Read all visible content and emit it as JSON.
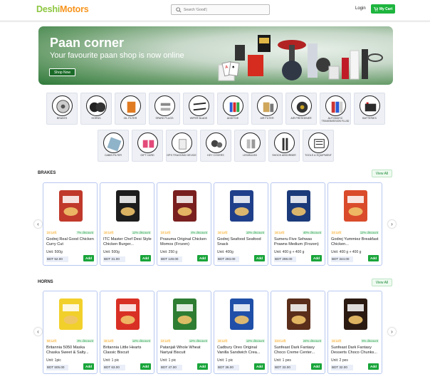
{
  "header": {
    "logo_part1": "Deshi",
    "logo_part2": "Motors",
    "search_placeholder": "Search 'Good'|",
    "login_label": "Login",
    "cart_label": "My Cart"
  },
  "banner": {
    "title": "Paan corner",
    "subtitle": "Your favourite paan shop is now online",
    "shop_button": "Shop Now"
  },
  "categories_row1": [
    {
      "label": "BRAKES",
      "icon": "brakes-icon"
    },
    {
      "label": "HORNS",
      "icon": "horn-icon"
    },
    {
      "label": "OIL FILTER",
      "icon": "oil-filter-icon"
    },
    {
      "label": "SPARK PLUGS",
      "icon": "spark-plug-icon"
    },
    {
      "label": "WIPER BLADE",
      "icon": "wiper-blade-icon"
    },
    {
      "label": "ADDITIVE",
      "icon": "additive-icon"
    },
    {
      "label": "AIR FILTER",
      "icon": "air-filter-icon"
    },
    {
      "label": "AIR FRESHENER",
      "icon": "air-freshener-icon"
    },
    {
      "label": "AUTOMATIC TRANSMISSION FLUID",
      "icon": "transmission-fluid-icon"
    },
    {
      "label": "BATTERIES",
      "icon": "battery-icon"
    }
  ],
  "categories_row2": [
    {
      "label": "CABIN FILTER",
      "icon": "cabin-filter-icon"
    },
    {
      "label": "GIFT CARD",
      "icon": "gift-card-icon"
    },
    {
      "label": "GPS TRACKING DEVICE",
      "icon": "gps-device-icon"
    },
    {
      "label": "KEY COVERS",
      "icon": "key-cover-icon"
    },
    {
      "label": "LED/BULBS",
      "icon": "bulb-icon"
    },
    {
      "label": "SHOCK ABSORBER",
      "icon": "shock-absorber-icon"
    },
    {
      "label": "TOOLS & EQUIPMENT",
      "icon": "tools-icon"
    }
  ],
  "sections": [
    {
      "title": "BRAKES",
      "view_all": "View All",
      "products": [
        {
          "left": "24 Left",
          "discount": "7% discount",
          "name": "Godrej Real Good Chicken Curry Cut",
          "unit": "Unit: 500g",
          "price": "BDT 52.00",
          "add": "Add",
          "color": "#c0392b"
        },
        {
          "left": "16 Left",
          "discount": "12% discount",
          "name": "ITC Master Chef Desi Style Chicken Burger...",
          "unit": "Unit: 500g",
          "price": "BDT 31.00",
          "add": "Add",
          "color": "#1d1d1d"
        },
        {
          "left": "24 Left",
          "discount": "4% discount",
          "name": "Prasuma Original Chicken Momos (Frozen)",
          "unit": "Unit: 250 g",
          "price": "BDT 149.00",
          "add": "Add",
          "color": "#7a1f1f"
        },
        {
          "left": "16 Left",
          "discount": "10% discount",
          "name": "Godrej Seafood Seafood Snack",
          "unit": "Unit: 400g",
          "price": "BDT 293.00",
          "add": "Add",
          "color": "#1f3f8a"
        },
        {
          "left": "16 Left",
          "discount": "40% discount",
          "name": "Sumeru Five Sehwas Prawns Medium (Frozen)",
          "unit": "Unit: 400 g + 400 g",
          "price": "BDT 298.00",
          "add": "Add",
          "color": "#1b3a7a"
        },
        {
          "left": "24 Left",
          "discount": "12% discount",
          "name": "Godrej Yummiez Breakfast Chicken...",
          "unit": "Unit: 400 g + 400 g",
          "price": "BDT 344.00",
          "add": "Add",
          "color": "#d94b2b"
        }
      ]
    },
    {
      "title": "HORNS",
      "view_all": "View All",
      "products": [
        {
          "left": "56 Left",
          "discount": "3% discount",
          "name": "Britannia 5050 Maska Chaska Sweet & Salty...",
          "unit": "Unit: 1pic",
          "price": "BDT 505.00",
          "add": "Add",
          "color": "#f2d02b"
        },
        {
          "left": "16 Left",
          "discount": "12% discount",
          "name": "Britannia Little Hearts Classic Biscuit",
          "unit": "Unit: 1 pic",
          "price": "BDT 63.00",
          "add": "Add",
          "color": "#d93025"
        },
        {
          "left": "24 Left",
          "discount": "12% discount",
          "name": "Patanjali Whole Wheat Nariyal Biscuit",
          "unit": "Unit: 1 pic",
          "price": "BDT 47.00",
          "add": "Add",
          "color": "#2e7d32"
        },
        {
          "left": "16 Left",
          "discount": "12% discount",
          "name": "Cadbury Oreo Original Vanilla Sandwich Crea...",
          "unit": "Unit: 1 pic",
          "price": "BDT 36.00",
          "add": "Add",
          "color": "#1f4fa8"
        },
        {
          "left": "224 Left",
          "discount": "24% discount",
          "name": "Sunfeast Dark Fantasy Choco Creme Center...",
          "unit": "Unit: 1 pes",
          "price": "BDT 33.00",
          "add": "Add",
          "color": "#5a2e1a"
        },
        {
          "left": "16 Left",
          "discount": "5% discount",
          "name": "Sunfeast Dark Fantasy Desserts Choco Chunks...",
          "unit": "Unit: 2 pes",
          "price": "BDT 32.00",
          "add": "Add",
          "color": "#2b1a12"
        }
      ]
    }
  ]
}
